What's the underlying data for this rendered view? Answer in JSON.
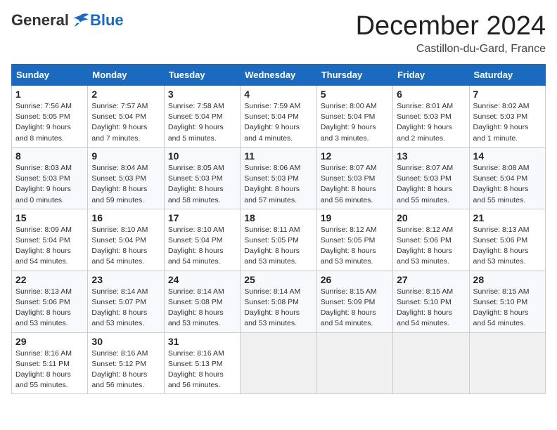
{
  "logo": {
    "general": "General",
    "blue": "Blue"
  },
  "title": "December 2024",
  "location": "Castillon-du-Gard, France",
  "days_header": [
    "Sunday",
    "Monday",
    "Tuesday",
    "Wednesday",
    "Thursday",
    "Friday",
    "Saturday"
  ],
  "weeks": [
    [
      {
        "day": "1",
        "info": "Sunrise: 7:56 AM\nSunset: 5:05 PM\nDaylight: 9 hours\nand 8 minutes."
      },
      {
        "day": "2",
        "info": "Sunrise: 7:57 AM\nSunset: 5:04 PM\nDaylight: 9 hours\nand 7 minutes."
      },
      {
        "day": "3",
        "info": "Sunrise: 7:58 AM\nSunset: 5:04 PM\nDaylight: 9 hours\nand 5 minutes."
      },
      {
        "day": "4",
        "info": "Sunrise: 7:59 AM\nSunset: 5:04 PM\nDaylight: 9 hours\nand 4 minutes."
      },
      {
        "day": "5",
        "info": "Sunrise: 8:00 AM\nSunset: 5:04 PM\nDaylight: 9 hours\nand 3 minutes."
      },
      {
        "day": "6",
        "info": "Sunrise: 8:01 AM\nSunset: 5:03 PM\nDaylight: 9 hours\nand 2 minutes."
      },
      {
        "day": "7",
        "info": "Sunrise: 8:02 AM\nSunset: 5:03 PM\nDaylight: 9 hours\nand 1 minute."
      }
    ],
    [
      {
        "day": "8",
        "info": "Sunrise: 8:03 AM\nSunset: 5:03 PM\nDaylight: 9 hours\nand 0 minutes."
      },
      {
        "day": "9",
        "info": "Sunrise: 8:04 AM\nSunset: 5:03 PM\nDaylight: 8 hours\nand 59 minutes."
      },
      {
        "day": "10",
        "info": "Sunrise: 8:05 AM\nSunset: 5:03 PM\nDaylight: 8 hours\nand 58 minutes."
      },
      {
        "day": "11",
        "info": "Sunrise: 8:06 AM\nSunset: 5:03 PM\nDaylight: 8 hours\nand 57 minutes."
      },
      {
        "day": "12",
        "info": "Sunrise: 8:07 AM\nSunset: 5:03 PM\nDaylight: 8 hours\nand 56 minutes."
      },
      {
        "day": "13",
        "info": "Sunrise: 8:07 AM\nSunset: 5:03 PM\nDaylight: 8 hours\nand 55 minutes."
      },
      {
        "day": "14",
        "info": "Sunrise: 8:08 AM\nSunset: 5:04 PM\nDaylight: 8 hours\nand 55 minutes."
      }
    ],
    [
      {
        "day": "15",
        "info": "Sunrise: 8:09 AM\nSunset: 5:04 PM\nDaylight: 8 hours\nand 54 minutes."
      },
      {
        "day": "16",
        "info": "Sunrise: 8:10 AM\nSunset: 5:04 PM\nDaylight: 8 hours\nand 54 minutes."
      },
      {
        "day": "17",
        "info": "Sunrise: 8:10 AM\nSunset: 5:04 PM\nDaylight: 8 hours\nand 54 minutes."
      },
      {
        "day": "18",
        "info": "Sunrise: 8:11 AM\nSunset: 5:05 PM\nDaylight: 8 hours\nand 53 minutes."
      },
      {
        "day": "19",
        "info": "Sunrise: 8:12 AM\nSunset: 5:05 PM\nDaylight: 8 hours\nand 53 minutes."
      },
      {
        "day": "20",
        "info": "Sunrise: 8:12 AM\nSunset: 5:06 PM\nDaylight: 8 hours\nand 53 minutes."
      },
      {
        "day": "21",
        "info": "Sunrise: 8:13 AM\nSunset: 5:06 PM\nDaylight: 8 hours\nand 53 minutes."
      }
    ],
    [
      {
        "day": "22",
        "info": "Sunrise: 8:13 AM\nSunset: 5:06 PM\nDaylight: 8 hours\nand 53 minutes."
      },
      {
        "day": "23",
        "info": "Sunrise: 8:14 AM\nSunset: 5:07 PM\nDaylight: 8 hours\nand 53 minutes."
      },
      {
        "day": "24",
        "info": "Sunrise: 8:14 AM\nSunset: 5:08 PM\nDaylight: 8 hours\nand 53 minutes."
      },
      {
        "day": "25",
        "info": "Sunrise: 8:14 AM\nSunset: 5:08 PM\nDaylight: 8 hours\nand 53 minutes."
      },
      {
        "day": "26",
        "info": "Sunrise: 8:15 AM\nSunset: 5:09 PM\nDaylight: 8 hours\nand 54 minutes."
      },
      {
        "day": "27",
        "info": "Sunrise: 8:15 AM\nSunset: 5:10 PM\nDaylight: 8 hours\nand 54 minutes."
      },
      {
        "day": "28",
        "info": "Sunrise: 8:15 AM\nSunset: 5:10 PM\nDaylight: 8 hours\nand 54 minutes."
      }
    ],
    [
      {
        "day": "29",
        "info": "Sunrise: 8:16 AM\nSunset: 5:11 PM\nDaylight: 8 hours\nand 55 minutes."
      },
      {
        "day": "30",
        "info": "Sunrise: 8:16 AM\nSunset: 5:12 PM\nDaylight: 8 hours\nand 56 minutes."
      },
      {
        "day": "31",
        "info": "Sunrise: 8:16 AM\nSunset: 5:13 PM\nDaylight: 8 hours\nand 56 minutes."
      },
      {
        "day": "",
        "info": ""
      },
      {
        "day": "",
        "info": ""
      },
      {
        "day": "",
        "info": ""
      },
      {
        "day": "",
        "info": ""
      }
    ]
  ]
}
